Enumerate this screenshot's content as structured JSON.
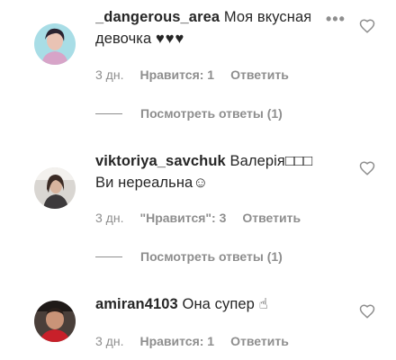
{
  "comments": [
    {
      "username": "_dangerous_area",
      "line1": "Моя вкусная",
      "line2": "девочка ",
      "hearts": "♥♥♥",
      "time": "3 дн.",
      "likes": "Нравится: 1",
      "reply": "Ответить",
      "view_replies": "Посмотреть ответы (1)",
      "more": "•••"
    },
    {
      "username": "viktoriya_savchuk",
      "line1": "Валерія□□□",
      "line2": "Ви нереальна☺",
      "time": "3 дн.",
      "likes": "\"Нравится\": 3",
      "reply": "Ответить",
      "view_replies": "Посмотреть ответы (1)"
    },
    {
      "username": "amiran4103",
      "line1": "Она супер ",
      "emoji": "☝",
      "time": "3 дн.",
      "likes": "Нравится: 1",
      "reply": "Ответить"
    }
  ]
}
